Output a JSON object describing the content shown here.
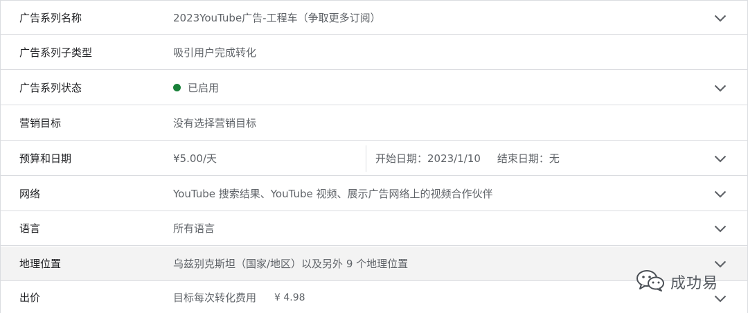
{
  "rows": [
    {
      "label": "广告系列名称",
      "value": "2023YouTube广告-工程车（争取更多订阅）",
      "expandable": true
    },
    {
      "label": "广告系列子类型",
      "value": "吸引用户完成转化",
      "expandable": false
    },
    {
      "label": "广告系列状态",
      "value": "已启用",
      "status_color": "#188038",
      "expandable": true
    },
    {
      "label": "营销目标",
      "value": "没有选择营销目标",
      "expandable": false
    },
    {
      "label": "预算和日期",
      "value": "¥5.00/天",
      "start_date": "开始日期：2023/1/10",
      "end_date": "结束日期：无",
      "expandable": true
    },
    {
      "label": "网络",
      "value": "YouTube 搜索结果、YouTube 视频、展示广告网络上的视频合作伙伴",
      "expandable": true
    },
    {
      "label": "语言",
      "value": "所有语言",
      "expandable": true
    },
    {
      "label": "地理位置",
      "value": "乌兹别克斯坦（国家/地区）以及另外 9 个地理位置",
      "expandable": true
    },
    {
      "label": "出价",
      "value": "目标每次转化费用",
      "price": "¥ 4.98",
      "expandable": true
    }
  ],
  "watermark": {
    "text": "成功易",
    "icon": "wechat-icon"
  },
  "colors": {
    "border": "#dadce0",
    "hover_row": "#f3f3f3",
    "status_green": "#188038",
    "chevron": "#5f6368"
  }
}
